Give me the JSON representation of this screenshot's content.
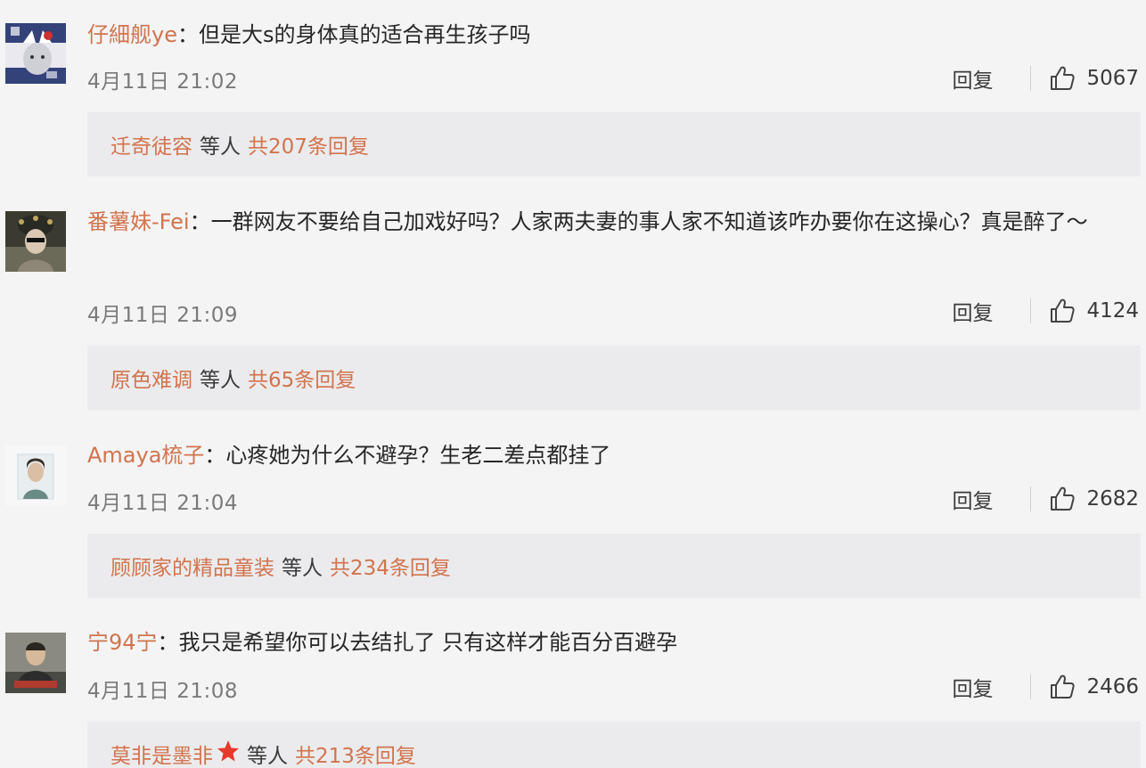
{
  "comments": [
    {
      "username": "仔細舰ye",
      "colon": "：",
      "text": "但是大s的身体真的适合再生孩子吗",
      "time": "4月11日 21:02",
      "reply_label": "回复",
      "likes": "5067",
      "replies": {
        "first_replier": "迁奇徒容",
        "mid": "等人",
        "count_text": "共207条回复"
      }
    },
    {
      "username": "番薯妹-Fei",
      "colon": "：",
      "text": "一群网友不要给自己加戏好吗？人家两夫妻的事人家不知道该咋办要你在这操心？真是醉了～",
      "time": "4月11日 21:09",
      "reply_label": "回复",
      "likes": "4124",
      "replies": {
        "first_replier": "原色难调",
        "mid": "等人",
        "count_text": "共65条回复"
      }
    },
    {
      "username": "Amaya梳子",
      "colon": "：",
      "text": "心疼她为什么不避孕？生老二差点都挂了",
      "time": "4月11日 21:04",
      "reply_label": "回复",
      "likes": "2682",
      "replies": {
        "first_replier": "顾顾家的精品童装",
        "mid": "等人",
        "count_text": "共234条回复"
      }
    },
    {
      "username": "宁94宁",
      "colon": "：",
      "text": "我只是希望你可以去结扎了 只有这样才能百分百避孕",
      "time": "4月11日 21:08",
      "reply_label": "回复",
      "likes": "2466",
      "replies": {
        "first_replier": "莫非是墨非",
        "mid": "等人",
        "count_text": "共213条回复",
        "icon": "star-icon"
      }
    }
  ],
  "colors": {
    "username": "#d2734d",
    "text": "#262626",
    "meta": "#7a7a7a",
    "reply_box_bg": "#ebebed",
    "page_bg": "#f4f4f5",
    "star": "#e8382a"
  }
}
